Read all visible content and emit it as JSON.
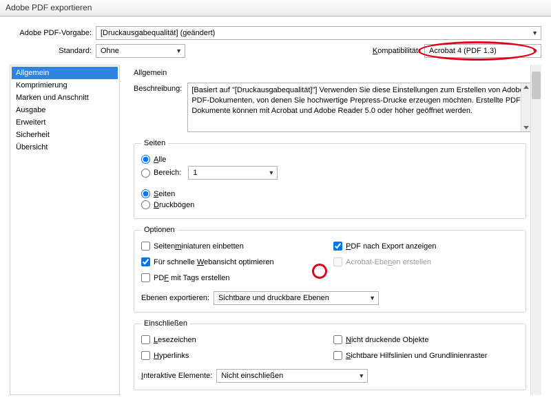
{
  "window_title": "Adobe PDF exportieren",
  "labels": {
    "preset": "Adobe PDF-Vorgabe:",
    "standard": "Standard:",
    "compat": "Kompatibilität:",
    "description": "Beschreibung:",
    "export_layers": "Ebenen exportieren:",
    "interactive": "Interaktive Elemente:"
  },
  "values": {
    "preset": "[Druckausgabequalität] (geändert)",
    "standard": "Ohne",
    "compat": "Acrobat 4 (PDF 1.3)",
    "description": "[Basiert auf \"[Druckausgabequalität]\"] Verwenden Sie diese Einstellungen zum Erstellen von Adobe PDF-Dokumenten, von denen Sie hochwertige Prepress-Drucke erzeugen möchten. Erstellte PDF-Dokumente können mit Acrobat und Adobe Reader 5.0 oder höher geöffnet werden.",
    "range": "1",
    "export_layers": "Sichtbare und druckbare Ebenen",
    "interactive": "Nicht einschließen"
  },
  "sidebar": [
    "Allgemein",
    "Komprimierung",
    "Marken und Anschnitt",
    "Ausgabe",
    "Erweitert",
    "Sicherheit",
    "Übersicht"
  ],
  "sections": {
    "general": "Allgemein",
    "pages": "Seiten",
    "options": "Optionen",
    "include": "Einschließen"
  },
  "pages": {
    "all": "Alle",
    "range": "Bereich:",
    "pages_radio": "Seiten",
    "spreads": "Druckbögen"
  },
  "options": {
    "thumbnails_pre": "Seiten",
    "thumbnails_u": "m",
    "thumbnails_post": "iniaturen einbetten",
    "fastweb_pre": "Für schnelle ",
    "fastweb_u": "W",
    "fastweb_post": "ebansicht optimieren",
    "tagged_pre": "PD",
    "tagged_u": "F",
    "tagged_post": " mit Tags erstellen",
    "viewafter_pre": "",
    "viewafter_u": "P",
    "viewafter_post": "DF nach Export anzeigen",
    "acroebenen_pre": "Acrobat-Ebe",
    "acroebenen_u": "n",
    "acroebenen_post": "en erstellen"
  },
  "include": {
    "bookmarks_u": "L",
    "bookmarks_post": "esezeichen",
    "hyperlinks_u": "H",
    "hyperlinks_post": "yperlinks",
    "nonprint_pre": "",
    "nonprint_u": "N",
    "nonprint_post": "icht druckende Objekte",
    "guides_pre": "",
    "guides_u": "S",
    "guides_post": "ichtbare Hilfslinien und Grundlinienraster"
  },
  "compat_label_u": "K",
  "compat_label_post": "ompatibilität:",
  "interactive_u": "I",
  "interactive_post": "nteraktive Elemente:"
}
